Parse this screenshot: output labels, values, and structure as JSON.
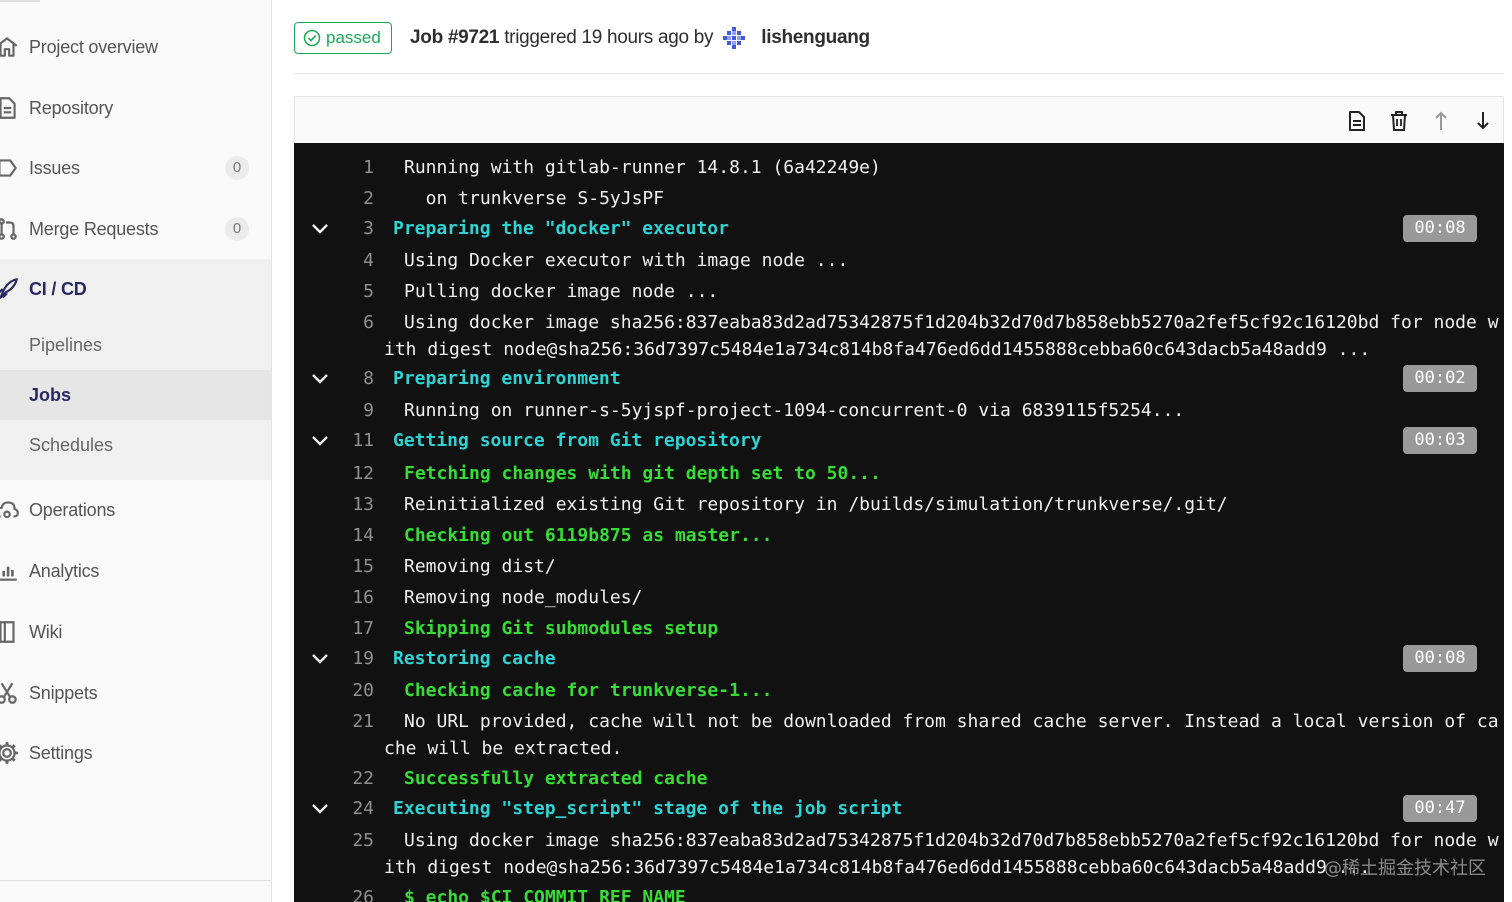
{
  "sidebar": {
    "items": [
      {
        "label": "Project overview",
        "icon": "home-icon"
      },
      {
        "label": "Repository",
        "icon": "document-icon"
      },
      {
        "label": "Issues",
        "icon": "issues-icon",
        "count": "0"
      },
      {
        "label": "Merge Requests",
        "icon": "merge-request-icon",
        "count": "0"
      },
      {
        "label": "CI / CD",
        "icon": "rocket-icon"
      },
      {
        "label": "Operations",
        "icon": "cloud-gear-icon"
      },
      {
        "label": "Analytics",
        "icon": "chart-icon"
      },
      {
        "label": "Wiki",
        "icon": "book-icon"
      },
      {
        "label": "Snippets",
        "icon": "scissors-icon"
      },
      {
        "label": "Settings",
        "icon": "gear-icon"
      }
    ],
    "cicd_sub": [
      {
        "label": "Pipelines"
      },
      {
        "label": "Jobs",
        "active": true
      },
      {
        "label": "Schedules"
      }
    ]
  },
  "header": {
    "status": "passed",
    "job_id": "Job #9721",
    "triggered_text": "triggered 19 hours ago by",
    "user": "lishenguang"
  },
  "toolbar": {
    "icons": [
      "raw-log-icon",
      "erase-log-icon",
      "scroll-to-top-icon",
      "scroll-to-bottom-icon"
    ]
  },
  "log": {
    "lines": [
      {
        "n": "1",
        "text": "Running with gitlab-runner 14.8.1 (6a42249e)"
      },
      {
        "n": "2",
        "text": "  on trunkverse S-5yJsPF"
      },
      {
        "n": "3",
        "text": "Preparing the \"docker\" executor",
        "section": true,
        "duration": "00:08"
      },
      {
        "n": "4",
        "text": "Using Docker executor with image node ..."
      },
      {
        "n": "5",
        "text": "Pulling docker image node ..."
      },
      {
        "n": "6",
        "text": "Using docker image sha256:837eaba83d2ad75342875f1d204b32d70d7b858ebb5270a2fef5cf92c16120bd for node w",
        "cont": "ith digest node@sha256:36d7397c5484e1a734c814b8fa476ed6dd1455888cebba60c643dacb5a48add9 ..."
      },
      {
        "n": "8",
        "text": "Preparing environment",
        "section": true,
        "duration": "00:02"
      },
      {
        "n": "9",
        "text": "Running on runner-s-5yjspf-project-1094-concurrent-0 via 6839115f5254..."
      },
      {
        "n": "11",
        "text": "Getting source from Git repository",
        "section": true,
        "duration": "00:03"
      },
      {
        "n": "12",
        "text": "Fetching changes with git depth set to 50...",
        "green": true
      },
      {
        "n": "13",
        "text": "Reinitialized existing Git repository in /builds/simulation/trunkverse/.git/"
      },
      {
        "n": "14",
        "text": "Checking out 6119b875 as master...",
        "green": true
      },
      {
        "n": "15",
        "text": "Removing dist/"
      },
      {
        "n": "16",
        "text": "Removing node_modules/"
      },
      {
        "n": "17",
        "text": "Skipping Git submodules setup",
        "green": true
      },
      {
        "n": "19",
        "text": "Restoring cache",
        "section": true,
        "duration": "00:08"
      },
      {
        "n": "20",
        "text": "Checking cache for trunkverse-1...",
        "green": true
      },
      {
        "n": "21",
        "text": "No URL provided, cache will not be downloaded from shared cache server. Instead a local version of ca",
        "cont": "che will be extracted."
      },
      {
        "n": "22",
        "text": "Successfully extracted cache",
        "green": true
      },
      {
        "n": "24",
        "text": "Executing \"step_script\" stage of the job script",
        "section": true,
        "duration": "00:47"
      },
      {
        "n": "25",
        "text": "Using docker image sha256:837eaba83d2ad75342875f1d204b32d70d7b858ebb5270a2fef5cf92c16120bd for node w",
        "cont": "ith digest node@sha256:36d7397c5484e1a734c814b8fa476ed6dd1455888cebba60c643dacb5a48add9 ..."
      },
      {
        "n": "26",
        "text": "$ echo $CI_COMMIT_REF_NAME",
        "green": true
      }
    ]
  },
  "watermark": "@稀土掘金技术社区",
  "colors": {
    "accent_nav": "#292961",
    "passed": "#1aaa55",
    "log_bg": "#111111",
    "log_section": "#2fd3d3",
    "log_green": "#37dc37"
  }
}
